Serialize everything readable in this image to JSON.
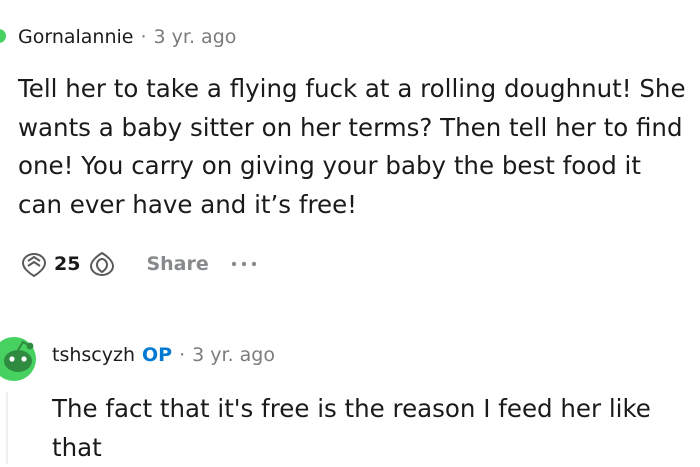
{
  "comment1": {
    "author": "Gornalannie",
    "separator": "·",
    "time": "3 yr. ago",
    "body": "Tell her to take a flying fuck at a rolling doughnut! She wants a baby sitter on her terms? Then tell her to find one! You carry on giving your baby the best food it can ever have and it’s free!",
    "votes": "25",
    "share_label": "Share"
  },
  "comment2": {
    "author": "tshscyzh",
    "op_badge": "OP",
    "separator": "·",
    "time": "3 yr. ago",
    "body": "The fact that it's free is the reason I feed her like that"
  },
  "colors": {
    "op_blue": "#0079d3",
    "meta_gray": "#7c7c7c",
    "avatar_green": "#46d160"
  },
  "icons": [
    "upvote-icon",
    "downvote-icon",
    "more-options-icon",
    "snoo-avatar-icon"
  ]
}
